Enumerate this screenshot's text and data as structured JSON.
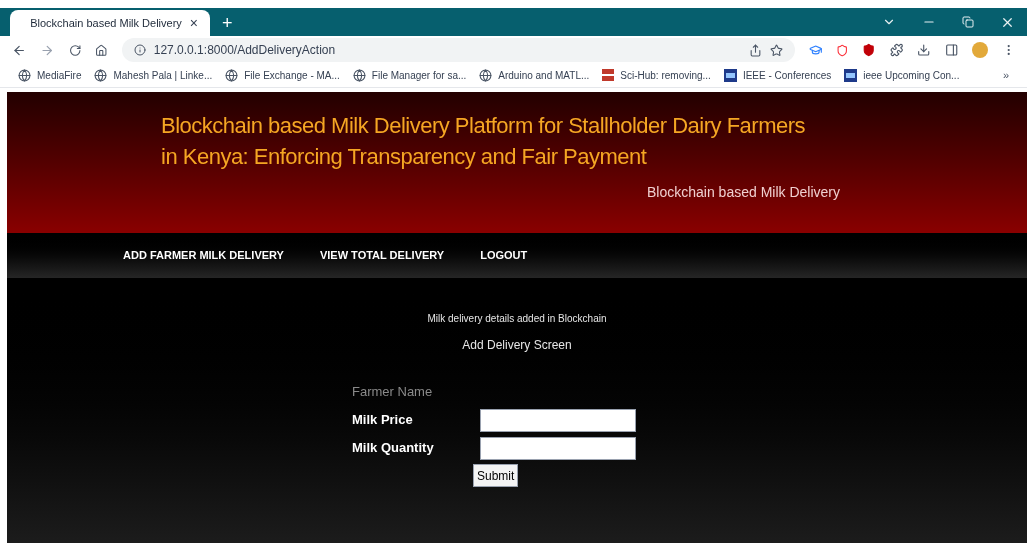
{
  "browser": {
    "tab": {
      "title": "Blockchain based Milk Delivery",
      "close": "×"
    },
    "new_tab": "+",
    "address": "127.0.0.1:8000/AddDeliveryAction",
    "bookmarks": [
      {
        "kind": "globe",
        "label": "MediaFire"
      },
      {
        "kind": "globe",
        "label": "Mahesh Pala | Linke..."
      },
      {
        "kind": "globe",
        "label": "File Exchange - MA..."
      },
      {
        "kind": "globe",
        "label": "File Manager for sa..."
      },
      {
        "kind": "globe",
        "label": "Arduino and MATL..."
      },
      {
        "kind": "scihub",
        "label": "Sci-Hub: removing..."
      },
      {
        "kind": "ieee",
        "label": "IEEE - Conferences"
      },
      {
        "kind": "ieee",
        "label": "ieee Upcoming Con..."
      }
    ],
    "more": "»"
  },
  "header": {
    "title_lines": [
      "Blockchain based Milk Delivery Platform for Stallholder Dairy Farmers",
      "in Kenya: Enforcing Transparency and Fair Payment"
    ],
    "subtitle": "Blockchain based Milk Delivery"
  },
  "nav": [
    "ADD FARMER MILK DELIVERY",
    "VIEW TOTAL DELIVERY",
    "LOGOUT"
  ],
  "content": {
    "message": "Milk delivery details added in Blockchain",
    "heading": "Add Delivery Screen",
    "fields": [
      {
        "kind": "label",
        "label": "Farmer Name",
        "disabled": true
      },
      {
        "kind": "input",
        "label": "Milk Price",
        "disabled": false
      },
      {
        "kind": "input",
        "label": "Milk Quantity",
        "disabled": false
      }
    ],
    "submit": "Submit"
  }
}
